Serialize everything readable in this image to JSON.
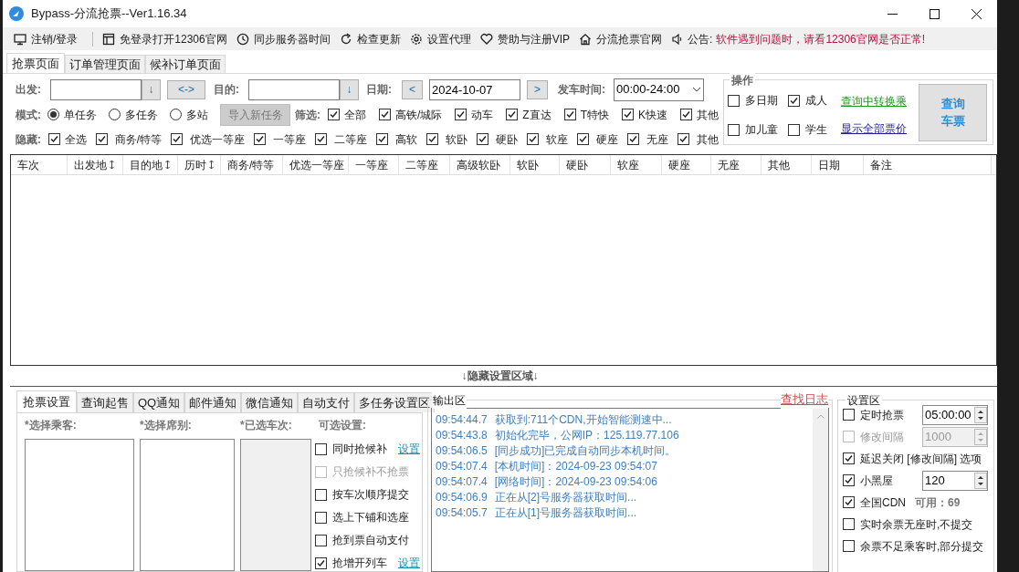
{
  "window": {
    "title": "Bypass-分流抢票--Ver1.16.34"
  },
  "toolbar": [
    {
      "kind": "monitor",
      "label": "注销/登录"
    },
    {
      "kind": "window",
      "label": "免登录打开12306官网"
    },
    {
      "kind": "clock",
      "label": "同步服务器时间"
    },
    {
      "kind": "refresh",
      "label": "检查更新"
    },
    {
      "kind": "gear",
      "label": "设置代理"
    },
    {
      "kind": "heart",
      "label": "赞助与注册VIP"
    },
    {
      "kind": "home",
      "label": "分流抢票官网"
    }
  ],
  "notice": {
    "label": "公告:",
    "text": "软件遇到问题时，请看12306官网是否正常!"
  },
  "tabs": [
    {
      "label": "抢票页面",
      "selected": true
    },
    {
      "label": "订单管理页面",
      "selected": false
    },
    {
      "label": "候补订单页面",
      "selected": false
    }
  ],
  "route": {
    "from_label": "出发:",
    "from_button": "↓",
    "swap_button": "<->",
    "to_label": "目的:",
    "to_button": "↓",
    "date_label": "日期:",
    "prev_button": "<",
    "date": "2024-10-07",
    "next_button": ">",
    "time_label": "发车时间:",
    "time": "00:00-24:00"
  },
  "mode": {
    "label": "模式:",
    "options": [
      {
        "label": "单任务",
        "selected": true
      },
      {
        "label": "多任务",
        "selected": false
      },
      {
        "label": "多站",
        "selected": false
      }
    ],
    "import_button": "导入新任务"
  },
  "filter": {
    "label": "筛选:",
    "items": [
      {
        "label": "全部",
        "checked": true
      },
      {
        "label": "高铁/城际",
        "checked": true
      },
      {
        "label": "动车",
        "checked": true
      },
      {
        "label": "Z直达",
        "checked": true
      },
      {
        "label": "T特快",
        "checked": true
      },
      {
        "label": "K快速",
        "checked": true
      },
      {
        "label": "其他",
        "checked": true
      }
    ]
  },
  "hide": {
    "label": "隐藏:",
    "items": [
      {
        "label": "全选",
        "checked": true
      },
      {
        "label": "商务/特等",
        "checked": true
      },
      {
        "label": "优选一等座",
        "checked": true
      },
      {
        "label": "一等座",
        "checked": true
      },
      {
        "label": "二等座",
        "checked": true
      },
      {
        "label": "高软",
        "checked": true
      },
      {
        "label": "软卧",
        "checked": true
      },
      {
        "label": "硬卧",
        "checked": true
      },
      {
        "label": "软座",
        "checked": true
      },
      {
        "label": "硬座",
        "checked": true
      },
      {
        "label": "无座",
        "checked": true
      },
      {
        "label": "其他",
        "checked": true
      }
    ]
  },
  "operations": {
    "title": "操作",
    "options": [
      {
        "label": "多日期",
        "checked": false
      },
      {
        "label": "成人",
        "checked": true
      },
      {
        "label": "加儿童",
        "checked": false
      },
      {
        "label": "学生",
        "checked": false
      }
    ],
    "links": [
      {
        "label": "查询中转换乘",
        "color": "#1a9c1a"
      },
      {
        "label": "显示全部票价",
        "color": "#1f1f8f"
      }
    ],
    "query_button": [
      "查询",
      "车票"
    ]
  },
  "table": {
    "columns": [
      {
        "label": "车次",
        "sortable": false
      },
      {
        "label": "出发地",
        "sortable": true
      },
      {
        "label": "目的地",
        "sortable": true
      },
      {
        "label": "历时",
        "sortable": true
      },
      {
        "label": "商务/特等",
        "sortable": false
      },
      {
        "label": "优选一等座",
        "sortable": false
      },
      {
        "label": "一等座",
        "sortable": false
      },
      {
        "label": "二等座",
        "sortable": false
      },
      {
        "label": "高级软卧",
        "sortable": false
      },
      {
        "label": "软卧",
        "sortable": false
      },
      {
        "label": "硬卧",
        "sortable": false
      },
      {
        "label": "软座",
        "sortable": false
      },
      {
        "label": "硬座",
        "sortable": false
      },
      {
        "label": "无座",
        "sortable": false
      },
      {
        "label": "其他",
        "sortable": false
      },
      {
        "label": "日期",
        "sortable": false
      },
      {
        "label": "备注",
        "sortable": false
      }
    ]
  },
  "hide_settings": "↓隐藏设置区域↓",
  "settings_tabs": [
    {
      "label": "抢票设置",
      "selected": true
    },
    {
      "label": "查询起售",
      "selected": false
    },
    {
      "label": "QQ通知",
      "selected": false
    },
    {
      "label": "邮件通知",
      "selected": false
    },
    {
      "label": "微信通知",
      "selected": false
    },
    {
      "label": "自动支付",
      "selected": false
    },
    {
      "label": "多任务设置区",
      "selected": false
    }
  ],
  "grab": {
    "passengers_label": "*选择乘客:",
    "seats_label": "*选择席别:",
    "trains_label": "*已选车次:",
    "options_label": "可选设置:",
    "options": [
      {
        "label": "同时抢候补",
        "checked": false,
        "disabled": false,
        "link": "设置"
      },
      {
        "label": "只抢候补不抢票",
        "checked": false,
        "disabled": true
      },
      {
        "label": "按车次顺序提交",
        "checked": false,
        "disabled": false
      },
      {
        "label": "选上下铺和选座",
        "checked": false,
        "disabled": false
      },
      {
        "label": "抢到票自动支付",
        "checked": false,
        "disabled": false
      },
      {
        "label": "抢增开列车",
        "checked": true,
        "disabled": false,
        "link": "设置"
      }
    ]
  },
  "output": {
    "title": "输出区",
    "link": "查找日志",
    "lines": [
      {
        "time": "09:54:44.7",
        "text": "获取到:711个CDN,开始智能测速中..."
      },
      {
        "time": "09:54:43.8",
        "text": "初始化完毕，公网IP：125.119.77.106"
      },
      {
        "time": "09:54:06.5",
        "text": "[同步成功]已完成自动同步本机时间。"
      },
      {
        "time": "09:54:07.4",
        "text": "[本机时间]：2024-09-23 09:54:07"
      },
      {
        "time": "09:54:07.4",
        "text": "[网络时间]：2024-09-23 09:54:06"
      },
      {
        "time": "09:54:06.9",
        "text": "正在从[2]号服务器获取时间..."
      },
      {
        "time": "09:54:05.7",
        "text": "正在从[1]号服务器获取时间..."
      }
    ]
  },
  "settings": {
    "title": "设置区",
    "items": [
      {
        "kind": "spinner",
        "label": "定时抢票",
        "checked": false,
        "value": "05:00:00",
        "disabled": false
      },
      {
        "kind": "spinner",
        "label": "修改间隔",
        "checked": false,
        "value": "1000",
        "disabled": true
      },
      {
        "kind": "plain",
        "label": "延迟关闭 [修改间隔] 选项",
        "checked": true
      },
      {
        "kind": "spinner",
        "label": "小黑屋",
        "checked": true,
        "value": "120",
        "disabled": false
      },
      {
        "kind": "note",
        "label": "全国CDN",
        "checked": true,
        "note": "可用：69"
      },
      {
        "kind": "plain",
        "label": "实时余票无座时,不提交",
        "checked": false
      },
      {
        "kind": "plain",
        "label": "余票不足乘客时,部分提交",
        "checked": false
      }
    ]
  }
}
